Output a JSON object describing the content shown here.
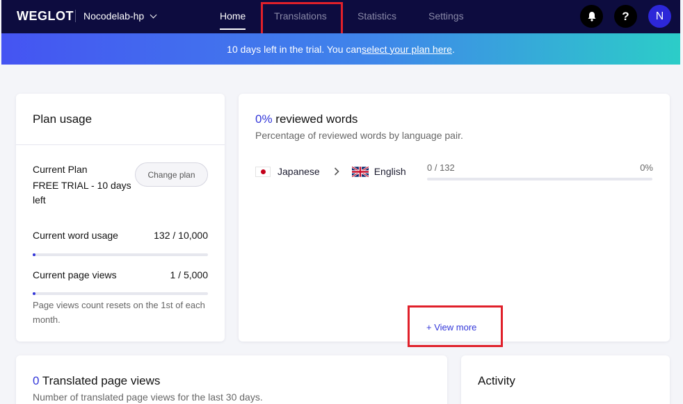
{
  "topbar": {
    "logo": "WEGLOT",
    "project": "Nocodelab-hp",
    "tabs": [
      {
        "label": "Home"
      },
      {
        "label": "Translations"
      },
      {
        "label": "Statistics"
      },
      {
        "label": "Settings"
      }
    ],
    "help_glyph": "?",
    "avatar_initial": "N"
  },
  "banner": {
    "text": "10 days left in the trial. You can ",
    "link": "select your plan here",
    "suffix": "."
  },
  "plan_usage": {
    "title": "Plan usage",
    "current_plan_label": "Current Plan",
    "current_plan_value": "FREE TRIAL - 10 days left",
    "change_plan_button": "Change plan",
    "word_usage_label": "Current word usage",
    "word_usage_value": "132 / 10,000",
    "word_usage_fraction": 0.0132,
    "page_views_label": "Current page views",
    "page_views_value": "1 / 5,000",
    "page_views_fraction": 0.0002,
    "note": "Page views count resets on the 1st of each month."
  },
  "reviewed": {
    "percent": "0%",
    "title_suffix": " reviewed words",
    "subtitle": "Percentage of reviewed words by language pair.",
    "pairs": [
      {
        "from": "Japanese",
        "to": "English",
        "count": "0 / 132",
        "percent": "0%",
        "fraction": 0
      }
    ],
    "view_more": "+ View more"
  },
  "translated_views": {
    "count": "0",
    "title_suffix": " Translated page views",
    "subtitle": "Number of translated page views for the last 30 days."
  },
  "activity": {
    "title": "Activity"
  },
  "colors": {
    "nav_bg": "#0d0c3f",
    "accent": "#3236d9",
    "highlight": "#e0202a"
  }
}
